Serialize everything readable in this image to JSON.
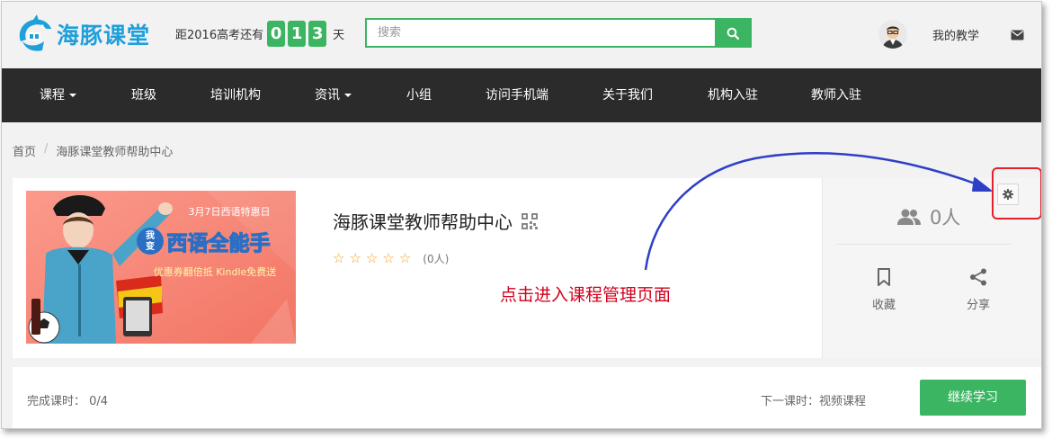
{
  "header": {
    "logo_text": "海豚课堂",
    "countdown": {
      "label": "距2016高考还有",
      "digits": [
        "0",
        "1",
        "3"
      ],
      "unit": "天"
    },
    "search": {
      "placeholder": "搜索",
      "value": ""
    },
    "my_teaching": "我的教学"
  },
  "nav": {
    "items": [
      {
        "label": "课程",
        "dropdown": true
      },
      {
        "label": "班级"
      },
      {
        "label": "培训机构"
      },
      {
        "label": "资讯",
        "dropdown": true
      },
      {
        "label": "小组"
      },
      {
        "label": "访问手机端"
      },
      {
        "label": "关于我们"
      },
      {
        "label": "机构入驻"
      },
      {
        "label": "教师入驻"
      }
    ]
  },
  "breadcrumb": {
    "home": "首页",
    "separator": "/",
    "current": "海豚课堂教师帮助中心"
  },
  "course": {
    "title": "海豚课堂教师帮助中心",
    "rating_stars": 0,
    "rating_count": "(0人)",
    "banner": {
      "date_line": "3月7日西语特惠日",
      "badge_top": "我",
      "badge_bottom": "变",
      "headline": "西语全能手",
      "sub": "优惠券翻倍抵 Kindle免费送"
    },
    "students": "0人",
    "favorite_label": "收藏",
    "share_label": "分享",
    "progress": "完成课时： 0/4",
    "next_lesson": "下一课时：视频课程",
    "continue_label": "继续学习"
  },
  "annotation": {
    "text": "点击进入课程管理页面"
  },
  "colors": {
    "accent_green": "#3cb563",
    "brand_blue": "#1fa0db",
    "nav_bg": "#2b2b2b",
    "annotation_red": "#d0021b",
    "arrow_blue": "#2f3fc6"
  }
}
